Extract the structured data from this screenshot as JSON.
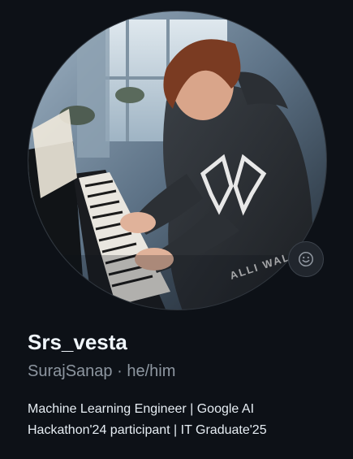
{
  "profile": {
    "display_name": "Srs_vesta",
    "username": "SurajSanap",
    "separator": "·",
    "pronouns": "he/him",
    "bio_line_1": "Machine Learning Engineer | Google AI",
    "bio_line_2": "Hackathon'24 participant | IT Graduate'25",
    "avatar_hoodie_text": "ALLI WALKER"
  },
  "icons": {
    "status": "smiley-icon"
  },
  "colors": {
    "background": "#0d1117",
    "name": "#f0f6fc",
    "muted": "#8d96a0",
    "text": "#e6edf3"
  }
}
